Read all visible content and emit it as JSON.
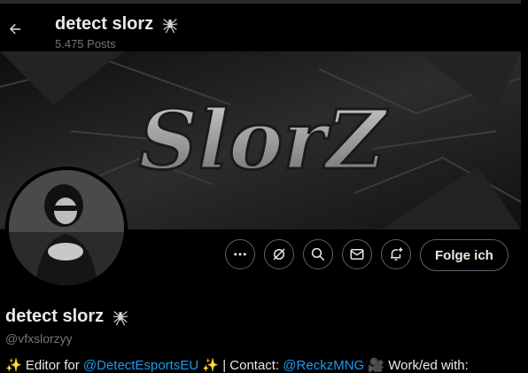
{
  "header": {
    "title": "detect slorz",
    "posts": "5.475 Posts"
  },
  "banner": {
    "logo_text": "SlorZ"
  },
  "profile": {
    "name": "detect slorz",
    "handle": "@vfxslorzyy",
    "follow_label": "Folge ich"
  },
  "bio": {
    "spark": "✨",
    "prefix": " Editor for ",
    "link1": "@DetectEsportsEU",
    "middle": " | Contact: ",
    "link2": "@ReckzMNG",
    "suffix": " Work/ed with:",
    "camera": "🎥"
  },
  "icons": [
    "back-arrow-icon",
    "spider-icon",
    "more-icon",
    "grok-icon",
    "search-icon",
    "mail-icon",
    "bell-plus-icon"
  ],
  "colors": {
    "background": "#000000",
    "text": "#e7e9ea",
    "muted": "#71767b",
    "link": "#1d9bf0",
    "border": "#536471"
  }
}
